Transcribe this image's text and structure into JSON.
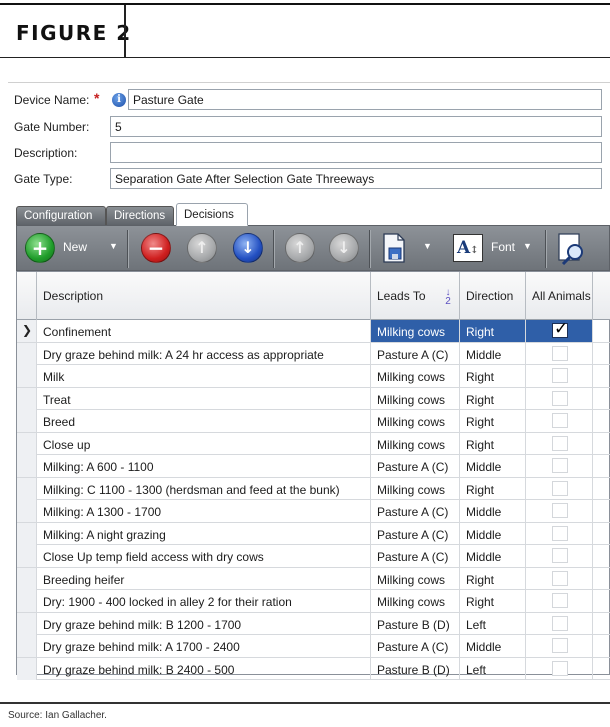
{
  "figure": {
    "title": "FIGURE 2",
    "source": "Source: Ian Gallacher."
  },
  "form": {
    "device_name_label": "Device Name:",
    "device_name_value": "Pasture Gate",
    "gate_number_label": "Gate Number:",
    "gate_number_value": "5",
    "description_label": "Description:",
    "description_value": "",
    "gate_type_label": "Gate Type:",
    "gate_type_value": "Separation Gate After Selection Gate Threeways"
  },
  "tabs": [
    {
      "label": "Configuration"
    },
    {
      "label": "Directions"
    },
    {
      "label": "Decisions"
    }
  ],
  "toolbar": {
    "new_label": "New",
    "font_label": "Font"
  },
  "grid": {
    "columns": [
      "Description",
      "Leads To",
      "Direction",
      "All Animals"
    ],
    "sort_digit": "2",
    "rows": [
      {
        "description": "Confinement",
        "leads_to": "Milking cows",
        "direction": "Right",
        "all_animals": true
      },
      {
        "description": "Dry graze behind milk: A 24 hr access as appropriate",
        "leads_to": "Pasture A (C)",
        "direction": "Middle",
        "all_animals": false
      },
      {
        "description": "Milk",
        "leads_to": "Milking cows",
        "direction": "Right",
        "all_animals": false
      },
      {
        "description": "Treat",
        "leads_to": "Milking cows",
        "direction": "Right",
        "all_animals": false
      },
      {
        "description": "Breed",
        "leads_to": "Milking cows",
        "direction": "Right",
        "all_animals": false
      },
      {
        "description": "Close up",
        "leads_to": "Milking cows",
        "direction": "Right",
        "all_animals": false
      },
      {
        "description": "Milking: A 600 - 1100",
        "leads_to": "Pasture A (C)",
        "direction": "Middle",
        "all_animals": false
      },
      {
        "description": "Milking: C 1100 - 1300 (herdsman and feed at the bunk)",
        "leads_to": "Milking cows",
        "direction": "Right",
        "all_animals": false
      },
      {
        "description": "Milking: A 1300 - 1700",
        "leads_to": "Pasture A (C)",
        "direction": "Middle",
        "all_animals": false
      },
      {
        "description": "Milking: A night grazing",
        "leads_to": "Pasture A (C)",
        "direction": "Middle",
        "all_animals": false
      },
      {
        "description": "Close Up temp field access with dry cows",
        "leads_to": "Pasture A (C)",
        "direction": "Middle",
        "all_animals": false
      },
      {
        "description": "Breeding heifer",
        "leads_to": "Milking cows",
        "direction": "Right",
        "all_animals": false
      },
      {
        "description": "Dry: 1900 - 400 locked in alley 2 for their ration",
        "leads_to": "Milking cows",
        "direction": "Right",
        "all_animals": false
      },
      {
        "description": "Dry graze behind milk: B 1200 - 1700",
        "leads_to": "Pasture B (D)",
        "direction": "Left",
        "all_animals": false
      },
      {
        "description": "Dry graze behind milk: A 1700 - 2400",
        "leads_to": "Pasture A (C)",
        "direction": "Middle",
        "all_animals": false
      },
      {
        "description": "Dry graze behind milk: B 2400 - 500",
        "leads_to": "Pasture B (D)",
        "direction": "Left",
        "all_animals": false
      }
    ]
  },
  "colors": {
    "selection": "#2f5fa8",
    "toolbar": "#7a7f85",
    "required": "#c62020"
  },
  "icons": [
    "add-icon",
    "remove-icon",
    "arrow-up-icon",
    "arrow-down-icon",
    "save-icon",
    "font-icon",
    "find-icon"
  ]
}
